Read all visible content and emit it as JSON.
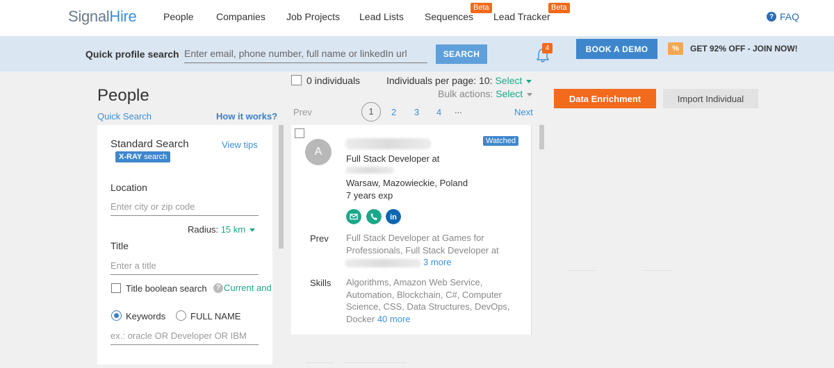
{
  "nav": {
    "logo_part1": "Signal",
    "logo_part2": "Hire",
    "items": [
      {
        "label": "People"
      },
      {
        "label": "Companies"
      },
      {
        "label": "Job Projects"
      },
      {
        "label": "Lead Lists"
      },
      {
        "label": "Sequences",
        "badge": "Beta"
      },
      {
        "label": "Lead Tracker",
        "badge": "Beta"
      }
    ],
    "faq": "FAQ"
  },
  "quick_search": {
    "label": "Quick profile search",
    "placeholder": "Enter email, phone number, full name or linkedIn url",
    "button": "SEARCH",
    "notifications": "4",
    "book_demo": "BOOK A DEMO",
    "promo": "GET 92% OFF - JOIN NOW!"
  },
  "sidebar": {
    "title": "People",
    "quick_search_link": "Quick Search",
    "how_it_works": "How it works?",
    "standard_search": "Standard Search",
    "view_tips": "View tips",
    "xray_bold": "X-RAY",
    "xray_rest": " search",
    "location_label": "Location",
    "location_placeholder": "Enter city or zip code",
    "radius_label": "Radius:",
    "radius_value": "15 km",
    "title_label": "Title",
    "title_placeholder": "Enter a title",
    "title_boolean": "Title boolean search",
    "current_and": "Current and P",
    "keywords_label": "Keywords",
    "fullname_label": "FULL NAME",
    "keywords_placeholder": "ex.: oracle OR Developer OR IBM"
  },
  "results": {
    "count": "0 individuals",
    "per_page_label": "Individuals per page: 10:",
    "per_page_select": "Select",
    "bulk_label": "Bulk actions:",
    "bulk_select": "Select",
    "prev": "Prev",
    "next": "Next",
    "pages": [
      "1",
      "2",
      "3",
      "4"
    ],
    "ellipsis": "...",
    "card": {
      "avatar": "A",
      "badge": "Watched",
      "title": "Full Stack Developer at",
      "location": "Warsaw, Mazowieckie, Poland",
      "experience": "7 years exp",
      "prev_label": "Prev",
      "prev_text": "Full Stack Developer at Games for Professionals, Full Stack Developer at",
      "prev_more": "3 more",
      "skills_label": "Skills",
      "skills_text": "Algorithms, Amazon Web Service, Automation, Blockchain, C#, Computer Science, CSS, Data Structures, DevOps, Docker",
      "skills_more": "40 more"
    }
  },
  "actions": {
    "enrichment": "Data Enrichment",
    "import": "Import Individual"
  },
  "colors": {
    "accent_orange": "#f26a1b",
    "accent_blue": "#3e86cc",
    "link_teal": "#1aa88a"
  }
}
